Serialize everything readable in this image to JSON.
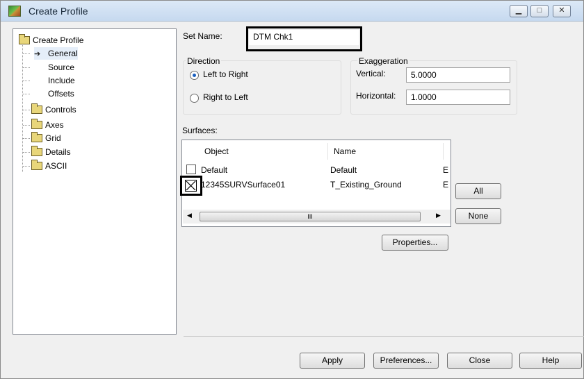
{
  "window": {
    "title": "Create Profile",
    "controls": [
      "▁",
      "□",
      "✕"
    ]
  },
  "tree": {
    "root_label": "Create Profile",
    "items": [
      {
        "label": "General",
        "icon": "arrow-icon"
      },
      {
        "label": "Source",
        "icon": "none"
      },
      {
        "label": "Include",
        "icon": "none"
      },
      {
        "label": "Offsets",
        "icon": "none"
      },
      {
        "label": "Controls",
        "icon": "folder-icon"
      },
      {
        "label": "Axes",
        "icon": "folder-icon"
      },
      {
        "label": "Grid",
        "icon": "folder-icon"
      },
      {
        "label": "Details",
        "icon": "folder-icon"
      },
      {
        "label": "ASCII",
        "icon": "folder-icon"
      }
    ]
  },
  "form": {
    "set_name_label": "Set Name:",
    "set_name_value": "DTM Chk1",
    "direction_label": "Direction",
    "direction_options": [
      "Left to Right",
      "Right to Left"
    ],
    "direction_selected": "Left to Right",
    "exaggeration_label": "Exaggeration",
    "vertical_label": "Vertical:",
    "vertical_value": "5.0000",
    "horizontal_label": "Horizontal:",
    "horizontal_value": "1.0000"
  },
  "surfaces": {
    "label": "Surfaces:",
    "columns": [
      "Object",
      "Name"
    ],
    "rows": [
      {
        "checked": false,
        "object": "Default",
        "name": "Default",
        "extra": "E"
      },
      {
        "checked": true,
        "object": "12345SURVSurface01",
        "name": "T_Existing_Ground",
        "extra": "E"
      }
    ],
    "scroll_marker": "III"
  },
  "buttons": {
    "all": "All",
    "none": "None",
    "properties": "Properties...",
    "apply": "Apply",
    "preferences": "Preferences...",
    "close": "Close",
    "help": "Help"
  }
}
